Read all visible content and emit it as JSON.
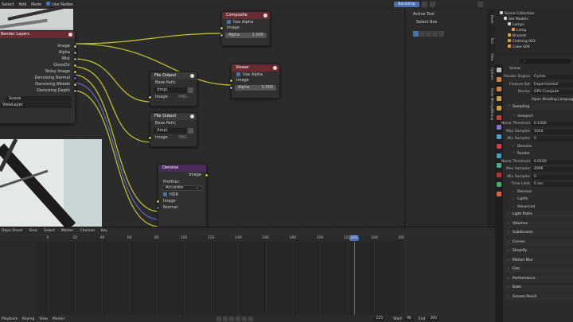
{
  "topbar": {
    "menu": [
      "Select",
      "Add",
      "Node"
    ],
    "use_nodes": "Use Nodes",
    "backdrop": "Backdrop"
  },
  "render_layers": {
    "title": "Render Layers",
    "outputs": [
      "Image",
      "Alpha",
      "Mist",
      "GlossDir",
      "Noisy Image",
      "Denoising Normal",
      "Denoising Albedo",
      "Denoising Depth"
    ],
    "scene": "Scene",
    "view_layer": "ViewLayer"
  },
  "composite": {
    "title": "Composite",
    "use_alpha": "Use Alpha",
    "image": "Image",
    "alpha": "Alpha",
    "alpha_val": "1.000"
  },
  "viewer": {
    "title": "Viewer",
    "use_alpha": "Use Alpha",
    "image": "Image",
    "alpha": "Alpha",
    "alpha_val": "1.000"
  },
  "file_output_1": {
    "title": "File Output",
    "base_path_label": "Base Path:",
    "path": "/tmp\\",
    "image": "Image",
    "format": "PNG"
  },
  "file_output_2": {
    "title": "File Output",
    "base_path_label": "Base Path:",
    "path": "/tmp\\",
    "image": "Image",
    "format": "PNG"
  },
  "denoise": {
    "title": "Denoise",
    "out_image": "Image",
    "prefilter_label": "Prefilter:",
    "prefilter": "Accurate",
    "hdr": "HDR",
    "in_image": "Image",
    "in_normal": "Normal"
  },
  "npanel": {
    "title": "Active Tool",
    "tool": "Select Box",
    "tabs": [
      "Node",
      "Tool",
      "View",
      "Options",
      "Node Wrangler",
      "Group"
    ]
  },
  "outliner": {
    "rows": [
      {
        "label": "Scene Collection",
        "indent": 0,
        "color": "#d0d0d0"
      },
      {
        "label": "Set Models",
        "indent": 1,
        "color": "#d0d0d0"
      },
      {
        "label": "Lamps",
        "indent": 2,
        "color": "#d0d0d0"
      },
      {
        "label": "Lamp",
        "indent": 3,
        "color": "#e0a040"
      },
      {
        "label": "Bracket",
        "indent": 2,
        "color": "#e0a040"
      },
      {
        "label": "Clothing 003",
        "indent": 2,
        "color": "#e0a040"
      },
      {
        "label": "Cube 009",
        "indent": 2,
        "color": "#e0a040"
      }
    ]
  },
  "properties": {
    "scene": "Scene",
    "rows": [
      {
        "t": "kv",
        "label": "Render Engine",
        "value": "Cycles"
      },
      {
        "t": "kv",
        "label": "Feature Set",
        "value": "Experimental"
      },
      {
        "t": "kv",
        "label": "Device",
        "value": "GPU Compute"
      },
      {
        "t": "chk",
        "label": "",
        "value": "Open Shading Language"
      },
      {
        "t": "sec",
        "label": "Sampling"
      },
      {
        "t": "sub",
        "label": "Viewport"
      },
      {
        "t": "kv",
        "label": "Noise Threshold",
        "value": "0.1000"
      },
      {
        "t": "kv",
        "label": "Max Samples",
        "value": "1024"
      },
      {
        "t": "kv",
        "label": "Min Samples",
        "value": "0"
      },
      {
        "t": "subc",
        "label": "Denoise"
      },
      {
        "t": "sub",
        "label": "Render"
      },
      {
        "t": "kv",
        "label": "Noise Threshold",
        "value": "0.0100"
      },
      {
        "t": "kv",
        "label": "Max Samples",
        "value": "4096"
      },
      {
        "t": "kv",
        "label": "Min Samples",
        "value": "0"
      },
      {
        "t": "kv",
        "label": "Time Limit",
        "value": "0 sec"
      },
      {
        "t": "subc",
        "label": "Denoise"
      },
      {
        "t": "subc",
        "label": "Lights"
      },
      {
        "t": "subc",
        "label": "Advanced"
      },
      {
        "t": "sec",
        "label": "Light Paths"
      },
      {
        "t": "sec",
        "label": "Volumes"
      },
      {
        "t": "sec",
        "label": "Subdivision"
      },
      {
        "t": "sec",
        "label": "Curves"
      },
      {
        "t": "sec",
        "label": "Simplify"
      },
      {
        "t": "sec",
        "label": "Motion Blur"
      },
      {
        "t": "sec",
        "label": "Film"
      },
      {
        "t": "sec",
        "label": "Performance"
      },
      {
        "t": "sec",
        "label": "Bake"
      },
      {
        "t": "sec",
        "label": "Grease Pencil"
      }
    ]
  },
  "timeline": {
    "header": [
      "Dope Sheet",
      "View",
      "Select",
      "Marker",
      "Channel",
      "Key"
    ],
    "ticks": [
      "0",
      "20",
      "40",
      "60",
      "80",
      "100",
      "120",
      "140",
      "160",
      "180",
      "200",
      "220",
      "240",
      "260"
    ],
    "current": "225",
    "footer": {
      "playback": "Playback",
      "keying": "Keying",
      "view": "View",
      "marker": "Marker",
      "frame": "225",
      "start_label": "Start",
      "start": "96",
      "end_label": "End",
      "end": "300"
    }
  }
}
